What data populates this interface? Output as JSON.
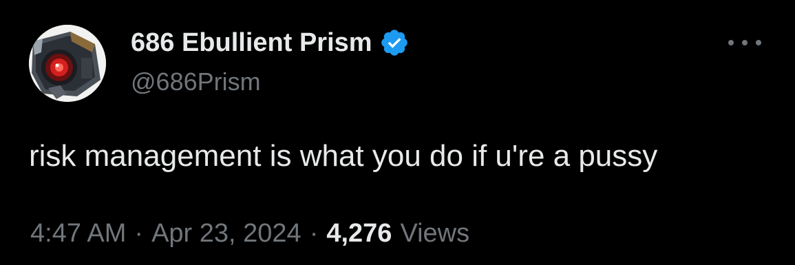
{
  "author": {
    "display_name": "686 Ebullient Prism",
    "handle": "@686Prism",
    "verified": true
  },
  "icons": {
    "avatar": "robot-eye-avatar",
    "verified": "verified-badge-icon",
    "more": "more-options-icon"
  },
  "tweet": {
    "text": "risk management is what you do if u're a pussy"
  },
  "meta": {
    "time": "4:47 AM",
    "separator": "·",
    "date": "Apr 23, 2024",
    "views_count": "4,276",
    "views_label": "Views"
  },
  "colors": {
    "background": "#000000",
    "primary_text": "#e7e9ea",
    "secondary_text": "#71767b",
    "verified_blue": "#1d9bf0"
  }
}
